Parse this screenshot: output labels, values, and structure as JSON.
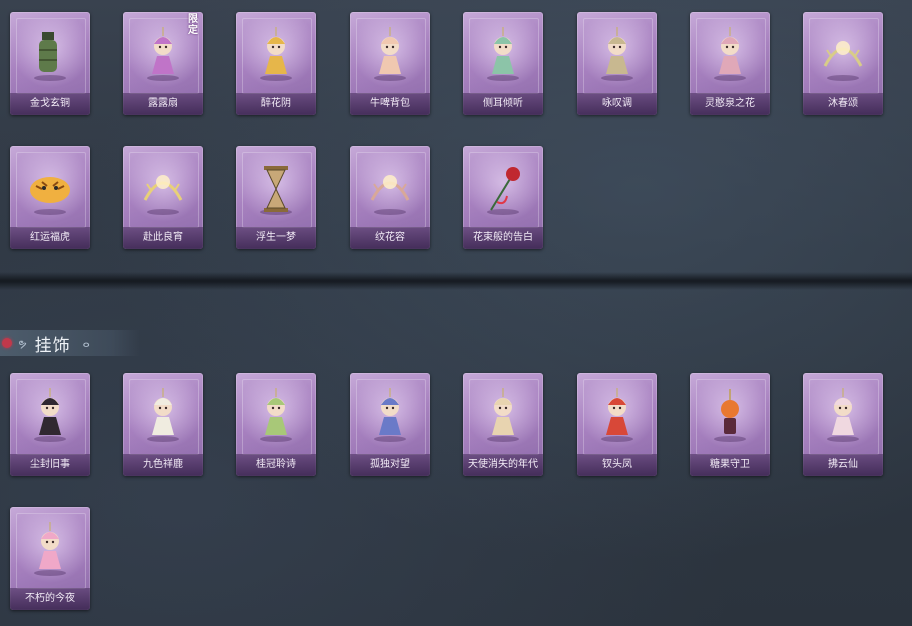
{
  "section_title": "挂饰",
  "limited_badge": "限定",
  "upper_items": [
    {
      "label": "金戈玄铜",
      "icon": "grenade-icon",
      "color": "#5e7a4a"
    },
    {
      "label": "露露扇",
      "icon": "bear-girl-icon",
      "color": "#c074c8"
    },
    {
      "label": "醉花阴",
      "icon": "flower-lantern-icon",
      "color": "#e6b64a"
    },
    {
      "label": "牛啤背包",
      "icon": "cow-barrel-icon",
      "color": "#f0c8b0"
    },
    {
      "label": "侧耳倾听",
      "icon": "teacup-icon",
      "color": "#8cc4a8"
    },
    {
      "label": "咏叹调",
      "icon": "lantern-icon",
      "color": "#c8b890"
    },
    {
      "label": "灵憨泉之花",
      "icon": "bouquet-icon",
      "color": "#e0a8b8"
    },
    {
      "label": "沐春颂",
      "icon": "branch-icon",
      "color": "#d8cc88"
    },
    {
      "label": "红运福虎",
      "icon": "tiger-icon",
      "color": "#f0b040"
    },
    {
      "label": "赴此良宵",
      "icon": "crystal-fan-icon",
      "color": "#e8d078"
    },
    {
      "label": "浮生一梦",
      "icon": "hourglass-icon",
      "color": "#c8a878"
    },
    {
      "label": "纹花容",
      "icon": "antler-icon",
      "color": "#d8a898"
    },
    {
      "label": "花束般的告白",
      "icon": "rose-icon",
      "color": "#c02830"
    }
  ],
  "lower_items": [
    {
      "label": "尘封旧事",
      "icon": "chibi-boy-icon",
      "color": "#302830"
    },
    {
      "label": "九色祥鹿",
      "icon": "deer-icon",
      "color": "#f0ece0"
    },
    {
      "label": "桂冠聆诗",
      "icon": "laurel-girl-icon",
      "color": "#a8c878"
    },
    {
      "label": "孤独对望",
      "icon": "mirror-charm-icon",
      "color": "#6a7ac8"
    },
    {
      "label": "天使消失的年代",
      "icon": "angel-icon",
      "color": "#e8d4b0"
    },
    {
      "label": "钗头凤",
      "icon": "phoenix-crown-icon",
      "color": "#d84838"
    },
    {
      "label": "糖果守卫",
      "icon": "pumpkin-icon",
      "color": "#e87830"
    },
    {
      "label": "拂云仙",
      "icon": "fairy-icon",
      "color": "#f0d8e0"
    },
    {
      "label": "不朽的今夜",
      "icon": "pink-cat-icon",
      "color": "#f0a8c8"
    }
  ]
}
